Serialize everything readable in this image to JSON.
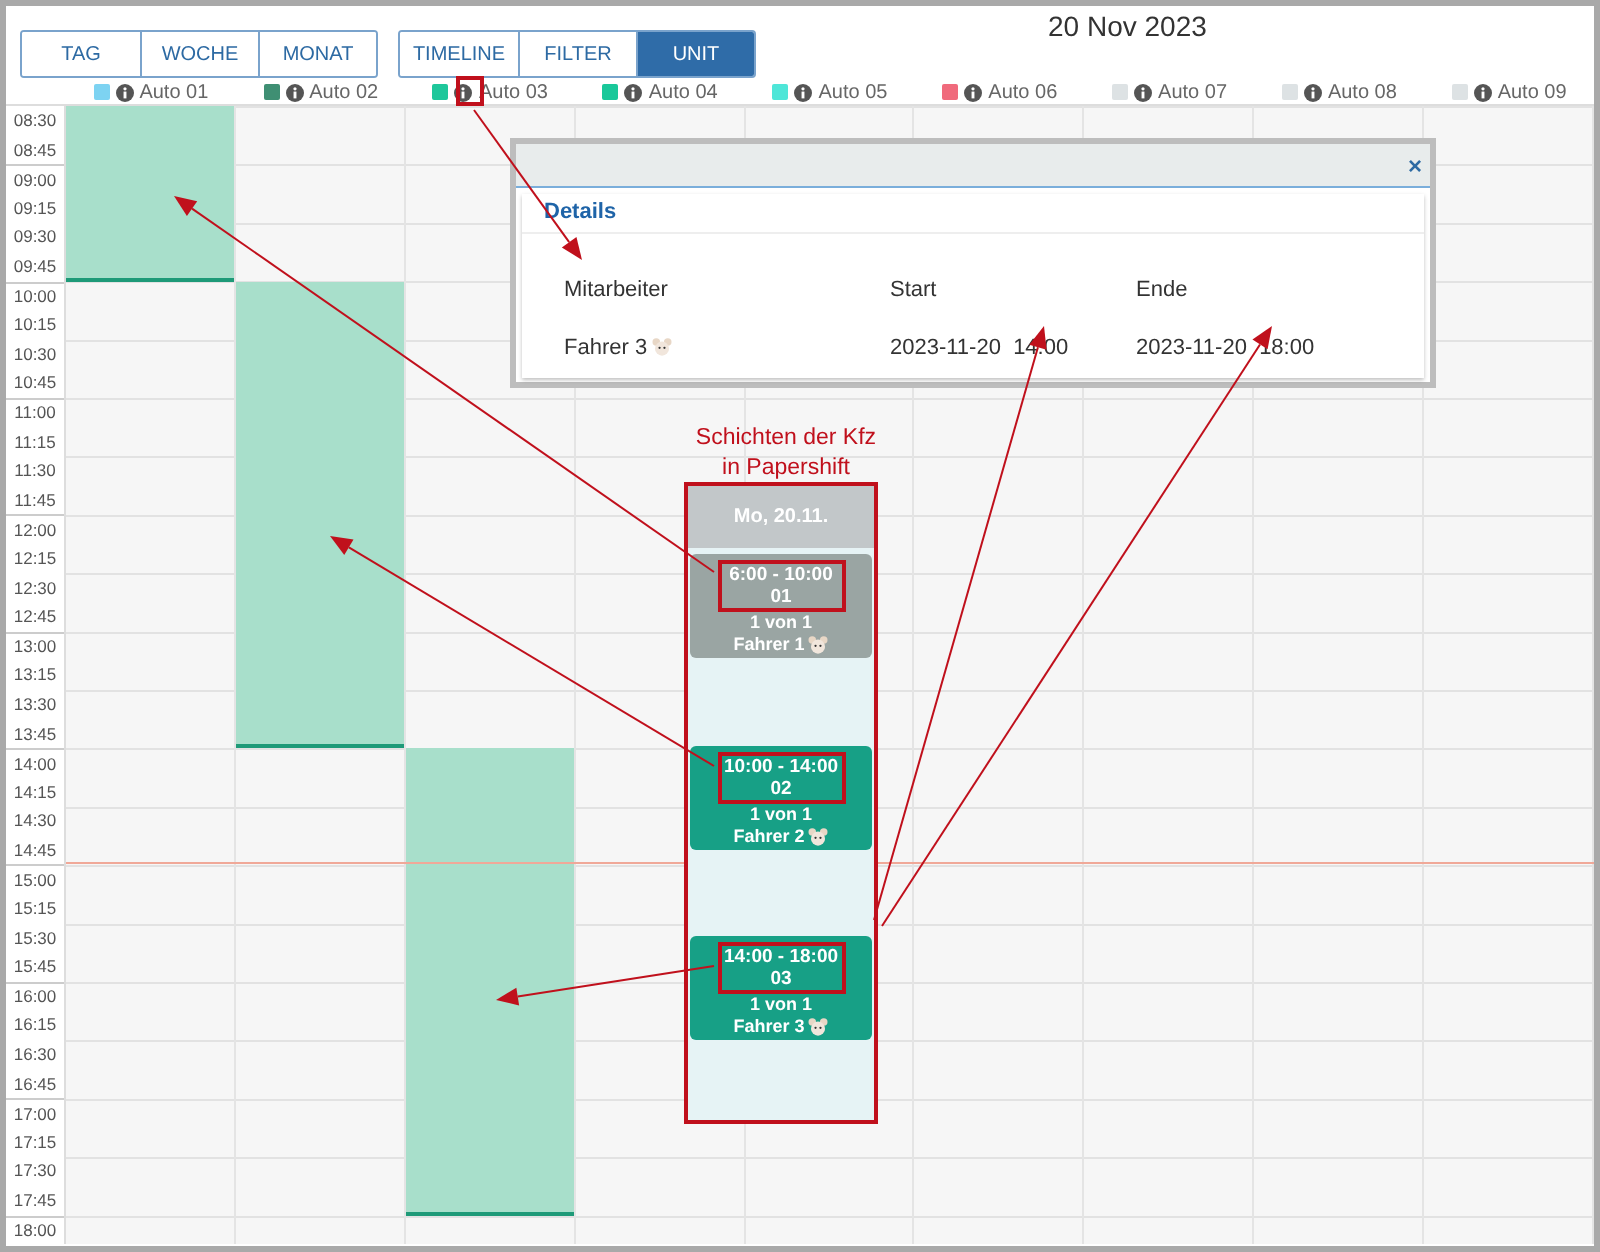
{
  "view_buttons": [
    {
      "label": "TAG",
      "selected": false
    },
    {
      "label": "WOCHE",
      "selected": false
    },
    {
      "label": "MONAT",
      "selected": false
    }
  ],
  "mode_buttons": [
    {
      "label": "TIMELINE",
      "selected": false
    },
    {
      "label": "FILTER",
      "selected": false
    },
    {
      "label": "UNIT",
      "selected": true
    }
  ],
  "date": "20 Nov 2023",
  "units": [
    {
      "name": "Auto 01",
      "color": "#7dd3f2",
      "booked": true
    },
    {
      "name": "Auto 02",
      "color": "#3f8f73",
      "booked": true
    },
    {
      "name": "Auto 03",
      "color": "#1ec79b",
      "booked": true
    },
    {
      "name": "Auto 04",
      "color": "#19c89a",
      "booked": false
    },
    {
      "name": "Auto 05",
      "color": "#4ee6d8",
      "booked": false
    },
    {
      "name": "Auto 06",
      "color": "#f06a7c",
      "booked": false
    },
    {
      "name": "Auto 07",
      "color": "#dde2e4",
      "booked": false
    },
    {
      "name": "Auto 08",
      "color": "#dde2e4",
      "booked": false
    },
    {
      "name": "Auto 09",
      "color": "#dde2e4",
      "booked": false
    }
  ],
  "time_slots": [
    "08:30",
    "08:45",
    "09:00",
    "09:15",
    "09:30",
    "09:45",
    "10:00",
    "10:15",
    "10:30",
    "10:45",
    "11:00",
    "11:15",
    "11:30",
    "11:45",
    "12:00",
    "12:15",
    "12:30",
    "12:45",
    "13:00",
    "13:15",
    "13:30",
    "13:45",
    "14:00",
    "14:15",
    "14:30",
    "14:45",
    "15:00",
    "15:15",
    "15:30",
    "15:45",
    "16:00",
    "16:15",
    "16:30",
    "16:45",
    "17:00",
    "17:15",
    "17:30",
    "17:45",
    "18:00"
  ],
  "dialog": {
    "close": "×",
    "title": "Details",
    "columns": [
      "Mitarbeiter",
      "Start",
      "Ende"
    ],
    "row": {
      "employee": "Fahrer 3",
      "start": "2023-11-20  14:00",
      "end": "2023-11-20  18:00"
    }
  },
  "annotation": {
    "caption": "Schichten der Kfz in Papershift",
    "day": "Mo, 20.11.",
    "shifts": [
      {
        "time": "6:00 - 10:00",
        "code": "01",
        "count": "1 von 1",
        "driver": "Fahrer 1",
        "past": true
      },
      {
        "time": "10:00 - 14:00",
        "code": "02",
        "count": "1 von 1",
        "driver": "Fahrer 2",
        "past": false
      },
      {
        "time": "14:00 - 18:00",
        "code": "03",
        "count": "1 von 1",
        "driver": "Fahrer 3",
        "past": false
      }
    ]
  }
}
